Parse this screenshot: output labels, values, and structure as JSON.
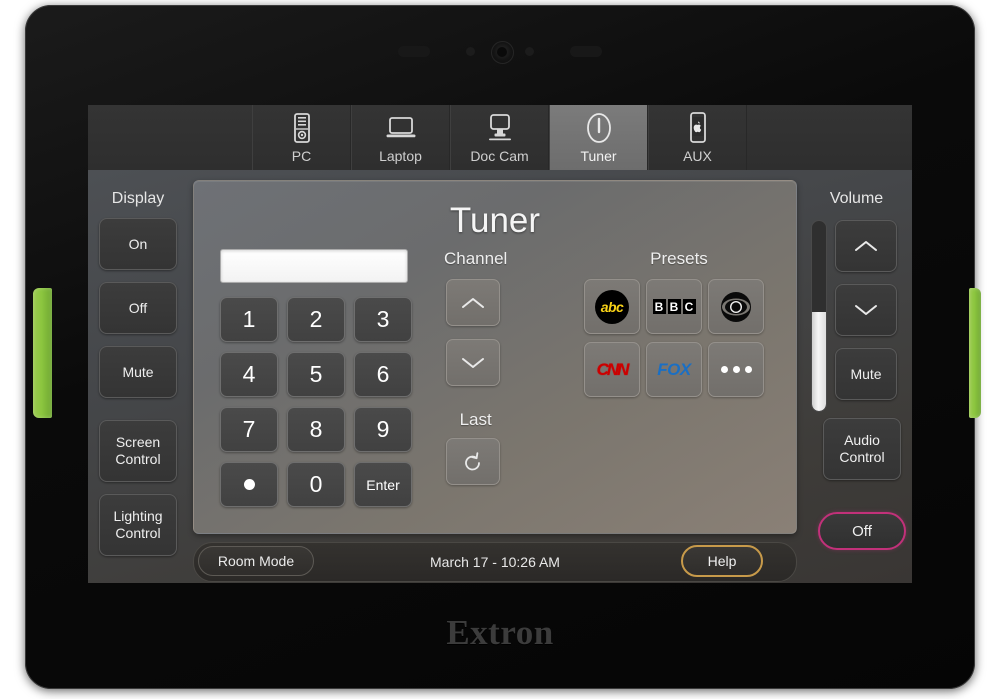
{
  "device": {
    "brand": "Extron",
    "accent_green": "#8cc63f",
    "bezel_color": "#0a0a0a"
  },
  "source_bar": {
    "tabs": [
      {
        "label": "PC",
        "icon": "desktop-tower-icon",
        "selected": false
      },
      {
        "label": "Laptop",
        "icon": "laptop-icon",
        "selected": false
      },
      {
        "label": "Doc Cam",
        "icon": "document-camera-icon",
        "selected": false
      },
      {
        "label": "Tuner",
        "icon": "power-icon",
        "selected": true
      },
      {
        "label": "AUX",
        "icon": "smartphone-icon",
        "selected": false
      }
    ]
  },
  "display_panel": {
    "title": "Display",
    "buttons": [
      {
        "label": "On"
      },
      {
        "label": "Off"
      },
      {
        "label": "Mute"
      },
      {
        "line1": "Screen",
        "line2": "Control"
      },
      {
        "line1": "Lighting",
        "line2": "Control"
      }
    ]
  },
  "volume_panel": {
    "title": "Volume",
    "slider_percent": 52,
    "up_icon": "chevron-up-icon",
    "down_icon": "chevron-down-icon",
    "mute_label": "Mute",
    "audio_control": {
      "line1": "Audio",
      "line2": "Control"
    },
    "power_off_label": "Off",
    "power_off_border_color": "#c2317a"
  },
  "main": {
    "title": "Tuner",
    "keypad": {
      "display_value": "",
      "keys": [
        {
          "label": "1"
        },
        {
          "label": "2"
        },
        {
          "label": "3"
        },
        {
          "label": "4"
        },
        {
          "label": "5"
        },
        {
          "label": "6"
        },
        {
          "label": "7"
        },
        {
          "label": "8"
        },
        {
          "label": "9"
        },
        {
          "label": "•",
          "icon": "dot-icon"
        },
        {
          "label": "0"
        },
        {
          "label": "Enter"
        }
      ]
    },
    "channel": {
      "title": "Channel",
      "up_icon": "chevron-up-icon",
      "down_icon": "chevron-down-icon",
      "last_title": "Last",
      "last_icon": "undo-arrow-icon"
    },
    "presets": {
      "title": "Presets",
      "items": [
        {
          "name": "abc",
          "icon": "abc-logo-icon",
          "color": "#f7d117"
        },
        {
          "name": "BBC",
          "icon": "bbc-logo-icon",
          "color": "#000000"
        },
        {
          "name": "CBS",
          "icon": "cbs-eye-icon",
          "color": "#000000"
        },
        {
          "name": "CNN",
          "icon": "cnn-logo-icon",
          "color": "#cc0000"
        },
        {
          "name": "FOX",
          "icon": "fox-logo-icon",
          "color": "#1a6fc4"
        },
        {
          "name": "More",
          "icon": "ellipsis-icon",
          "color": "#ffffff"
        }
      ]
    }
  },
  "status_bar": {
    "room_mode_label": "Room Mode",
    "clock": "March 17 - 10:26 AM",
    "help_label": "Help",
    "help_border_color": "#c79a4a"
  }
}
